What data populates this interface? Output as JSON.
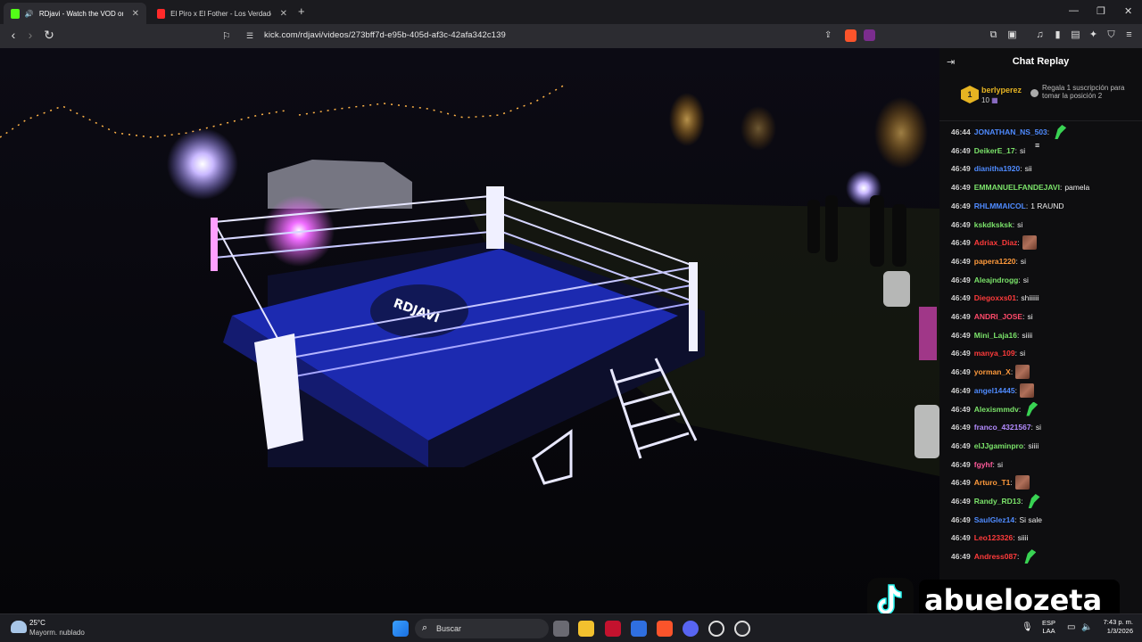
{
  "browser": {
    "tabs": [
      {
        "title": "RDjavi - Watch the VOD on K",
        "active": true,
        "favicon_color": "#53fc18"
      },
      {
        "title": "El Piro x El Fother - Los Verdaderos C",
        "active": false,
        "favicon_color": "#ff2a2a"
      }
    ],
    "url": "kick.com/rdjavi/videos/273bff7d-e95b-405d-af3c-42afa342c139"
  },
  "chat": {
    "title": "Chat Replay",
    "pinned": {
      "rank": "1",
      "username": "berlyperez",
      "count": "10",
      "gift_text": "Regala 1 suscripción para tomar la posición 2"
    },
    "messages": [
      {
        "time": "46:44",
        "user": "JONATHAN_NS_503",
        "color": "#4f8bff",
        "text": "",
        "emote": "green"
      },
      {
        "time": "46:49",
        "user": "DeikerE_17",
        "color": "#7be36a",
        "text": "si",
        "emote": ""
      },
      {
        "time": "46:49",
        "user": "dianitha1920",
        "color": "#4f8bff",
        "text": "sii",
        "emote": ""
      },
      {
        "time": "46:49",
        "user": "EMMANUELFANDEJAVI",
        "color": "#7be36a",
        "text": "pamela",
        "emote": ""
      },
      {
        "time": "46:49",
        "user": "RHLMMAICOL",
        "color": "#4f8bff",
        "text": "1 RAUND",
        "emote": ""
      },
      {
        "time": "46:49",
        "user": "kskdksksk",
        "color": "#7be36a",
        "text": "si",
        "emote": ""
      },
      {
        "time": "46:49",
        "user": "Adriax_Diaz",
        "color": "#ff3b3b",
        "text": "",
        "emote": "photo"
      },
      {
        "time": "46:49",
        "user": "papera1220",
        "color": "#ff9a3c",
        "text": "si",
        "emote": ""
      },
      {
        "time": "46:49",
        "user": "Aleajndrogg",
        "color": "#7be36a",
        "text": "si",
        "emote": ""
      },
      {
        "time": "46:49",
        "user": "Diegoxxs01",
        "color": "#ff3b3b",
        "text": "shiiiiii",
        "emote": ""
      },
      {
        "time": "46:49",
        "user": "ANDRI_JOSE",
        "color": "#ff4a6a",
        "text": "si",
        "emote": ""
      },
      {
        "time": "46:49",
        "user": "Mini_Laja16",
        "color": "#7be36a",
        "text": "siiii",
        "emote": ""
      },
      {
        "time": "46:49",
        "user": "manya_109",
        "color": "#ff3b3b",
        "text": "si",
        "emote": ""
      },
      {
        "time": "46:49",
        "user": "yorman_X",
        "color": "#ff9a3c",
        "text": "",
        "emote": "photo"
      },
      {
        "time": "46:49",
        "user": "angel14445",
        "color": "#4f8bff",
        "text": "",
        "emote": "photo"
      },
      {
        "time": "46:49",
        "user": "Alexismmdv",
        "color": "#7be36a",
        "text": "",
        "emote": "green"
      },
      {
        "time": "46:49",
        "user": "franco_4321567",
        "color": "#b48cff",
        "text": "si",
        "emote": ""
      },
      {
        "time": "46:49",
        "user": "elJJgaminpro",
        "color": "#7be36a",
        "text": "siiii",
        "emote": ""
      },
      {
        "time": "46:49",
        "user": "fgyhf",
        "color": "#ff5a9a",
        "text": "si",
        "emote": ""
      },
      {
        "time": "46:49",
        "user": "Arturo_T1",
        "color": "#ff9a3c",
        "text": "",
        "emote": "photo"
      },
      {
        "time": "46:49",
        "user": "Randy_RD13",
        "color": "#7be36a",
        "text": "",
        "emote": "green"
      },
      {
        "time": "46:49",
        "user": "SaulGlez14",
        "color": "#4f8bff",
        "text": "Si sale",
        "emote": ""
      },
      {
        "time": "46:49",
        "user": "Leo123326",
        "color": "#ff3b3b",
        "text": "siiii",
        "emote": ""
      },
      {
        "time": "46:49",
        "user": "Andress087",
        "color": "#ff3b3b",
        "text": "",
        "emote": "green"
      }
    ]
  },
  "watermark": {
    "name": "abuelozeta_"
  },
  "taskbar": {
    "temperature": "25°C",
    "weather": "Mayorm. nublado",
    "search_placeholder": "Buscar",
    "lang_line1": "ESP",
    "lang_line2": "LAA",
    "time": "7:43 p. m.",
    "date": "1/3/2026"
  }
}
